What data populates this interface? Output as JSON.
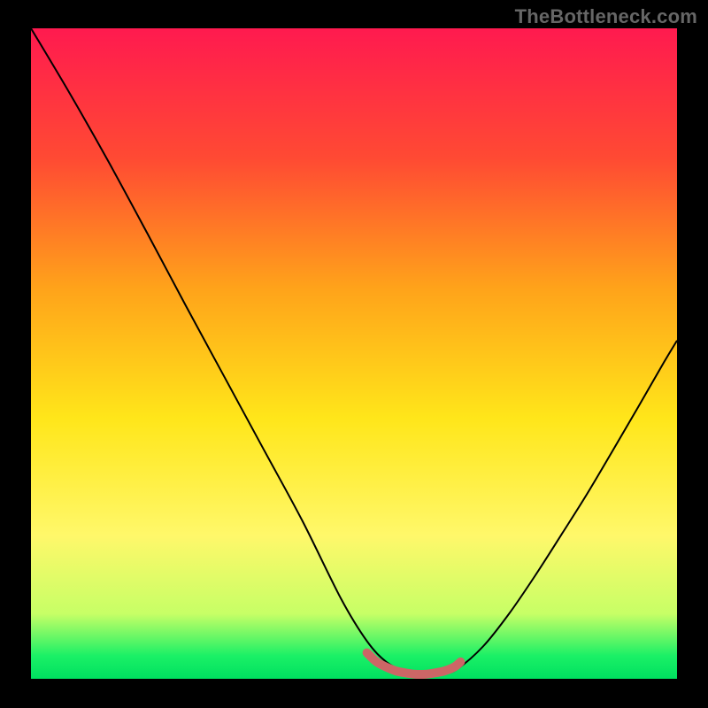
{
  "watermark": "TheBottleneck.com",
  "chart_data": {
    "type": "line",
    "title": "",
    "xlabel": "",
    "ylabel": "",
    "xlim": [
      0,
      100
    ],
    "ylim": [
      0,
      100
    ],
    "background_gradient": {
      "stops": [
        {
          "offset": 0.0,
          "color": "#ff1a4f"
        },
        {
          "offset": 0.2,
          "color": "#ff4a33"
        },
        {
          "offset": 0.4,
          "color": "#ffa31a"
        },
        {
          "offset": 0.6,
          "color": "#ffe61a"
        },
        {
          "offset": 0.78,
          "color": "#fff86a"
        },
        {
          "offset": 0.9,
          "color": "#c7ff66"
        },
        {
          "offset": 0.965,
          "color": "#1af066"
        },
        {
          "offset": 1.0,
          "color": "#00e060"
        }
      ]
    },
    "series": [
      {
        "name": "bottleneck-curve",
        "color": "#000000",
        "stroke_width": 2.0,
        "x": [
          0,
          6,
          12,
          18,
          24,
          30,
          36,
          42,
          48,
          52,
          55,
          58,
          60,
          62,
          64,
          66,
          70,
          74,
          78,
          82,
          86,
          90,
          94,
          98,
          100
        ],
        "y": [
          100,
          90.0,
          79.5,
          68.5,
          57.3,
          46.3,
          35.3,
          24.3,
          12.3,
          5.8,
          2.6,
          1.0,
          0.5,
          0.5,
          0.8,
          1.5,
          5.0,
          10.0,
          15.8,
          22.0,
          28.3,
          35.0,
          41.8,
          48.7,
          52.0
        ]
      },
      {
        "name": "optimal-band",
        "color": "#cc6666",
        "stroke_width": 10,
        "linecap": "round",
        "x": [
          52,
          53.5,
          55,
          56.5,
          58,
          59.5,
          61,
          62.5,
          64,
          65.5,
          66.5
        ],
        "y": [
          4.0,
          2.6,
          1.8,
          1.2,
          0.9,
          0.7,
          0.7,
          0.9,
          1.2,
          1.8,
          2.6
        ]
      }
    ]
  }
}
